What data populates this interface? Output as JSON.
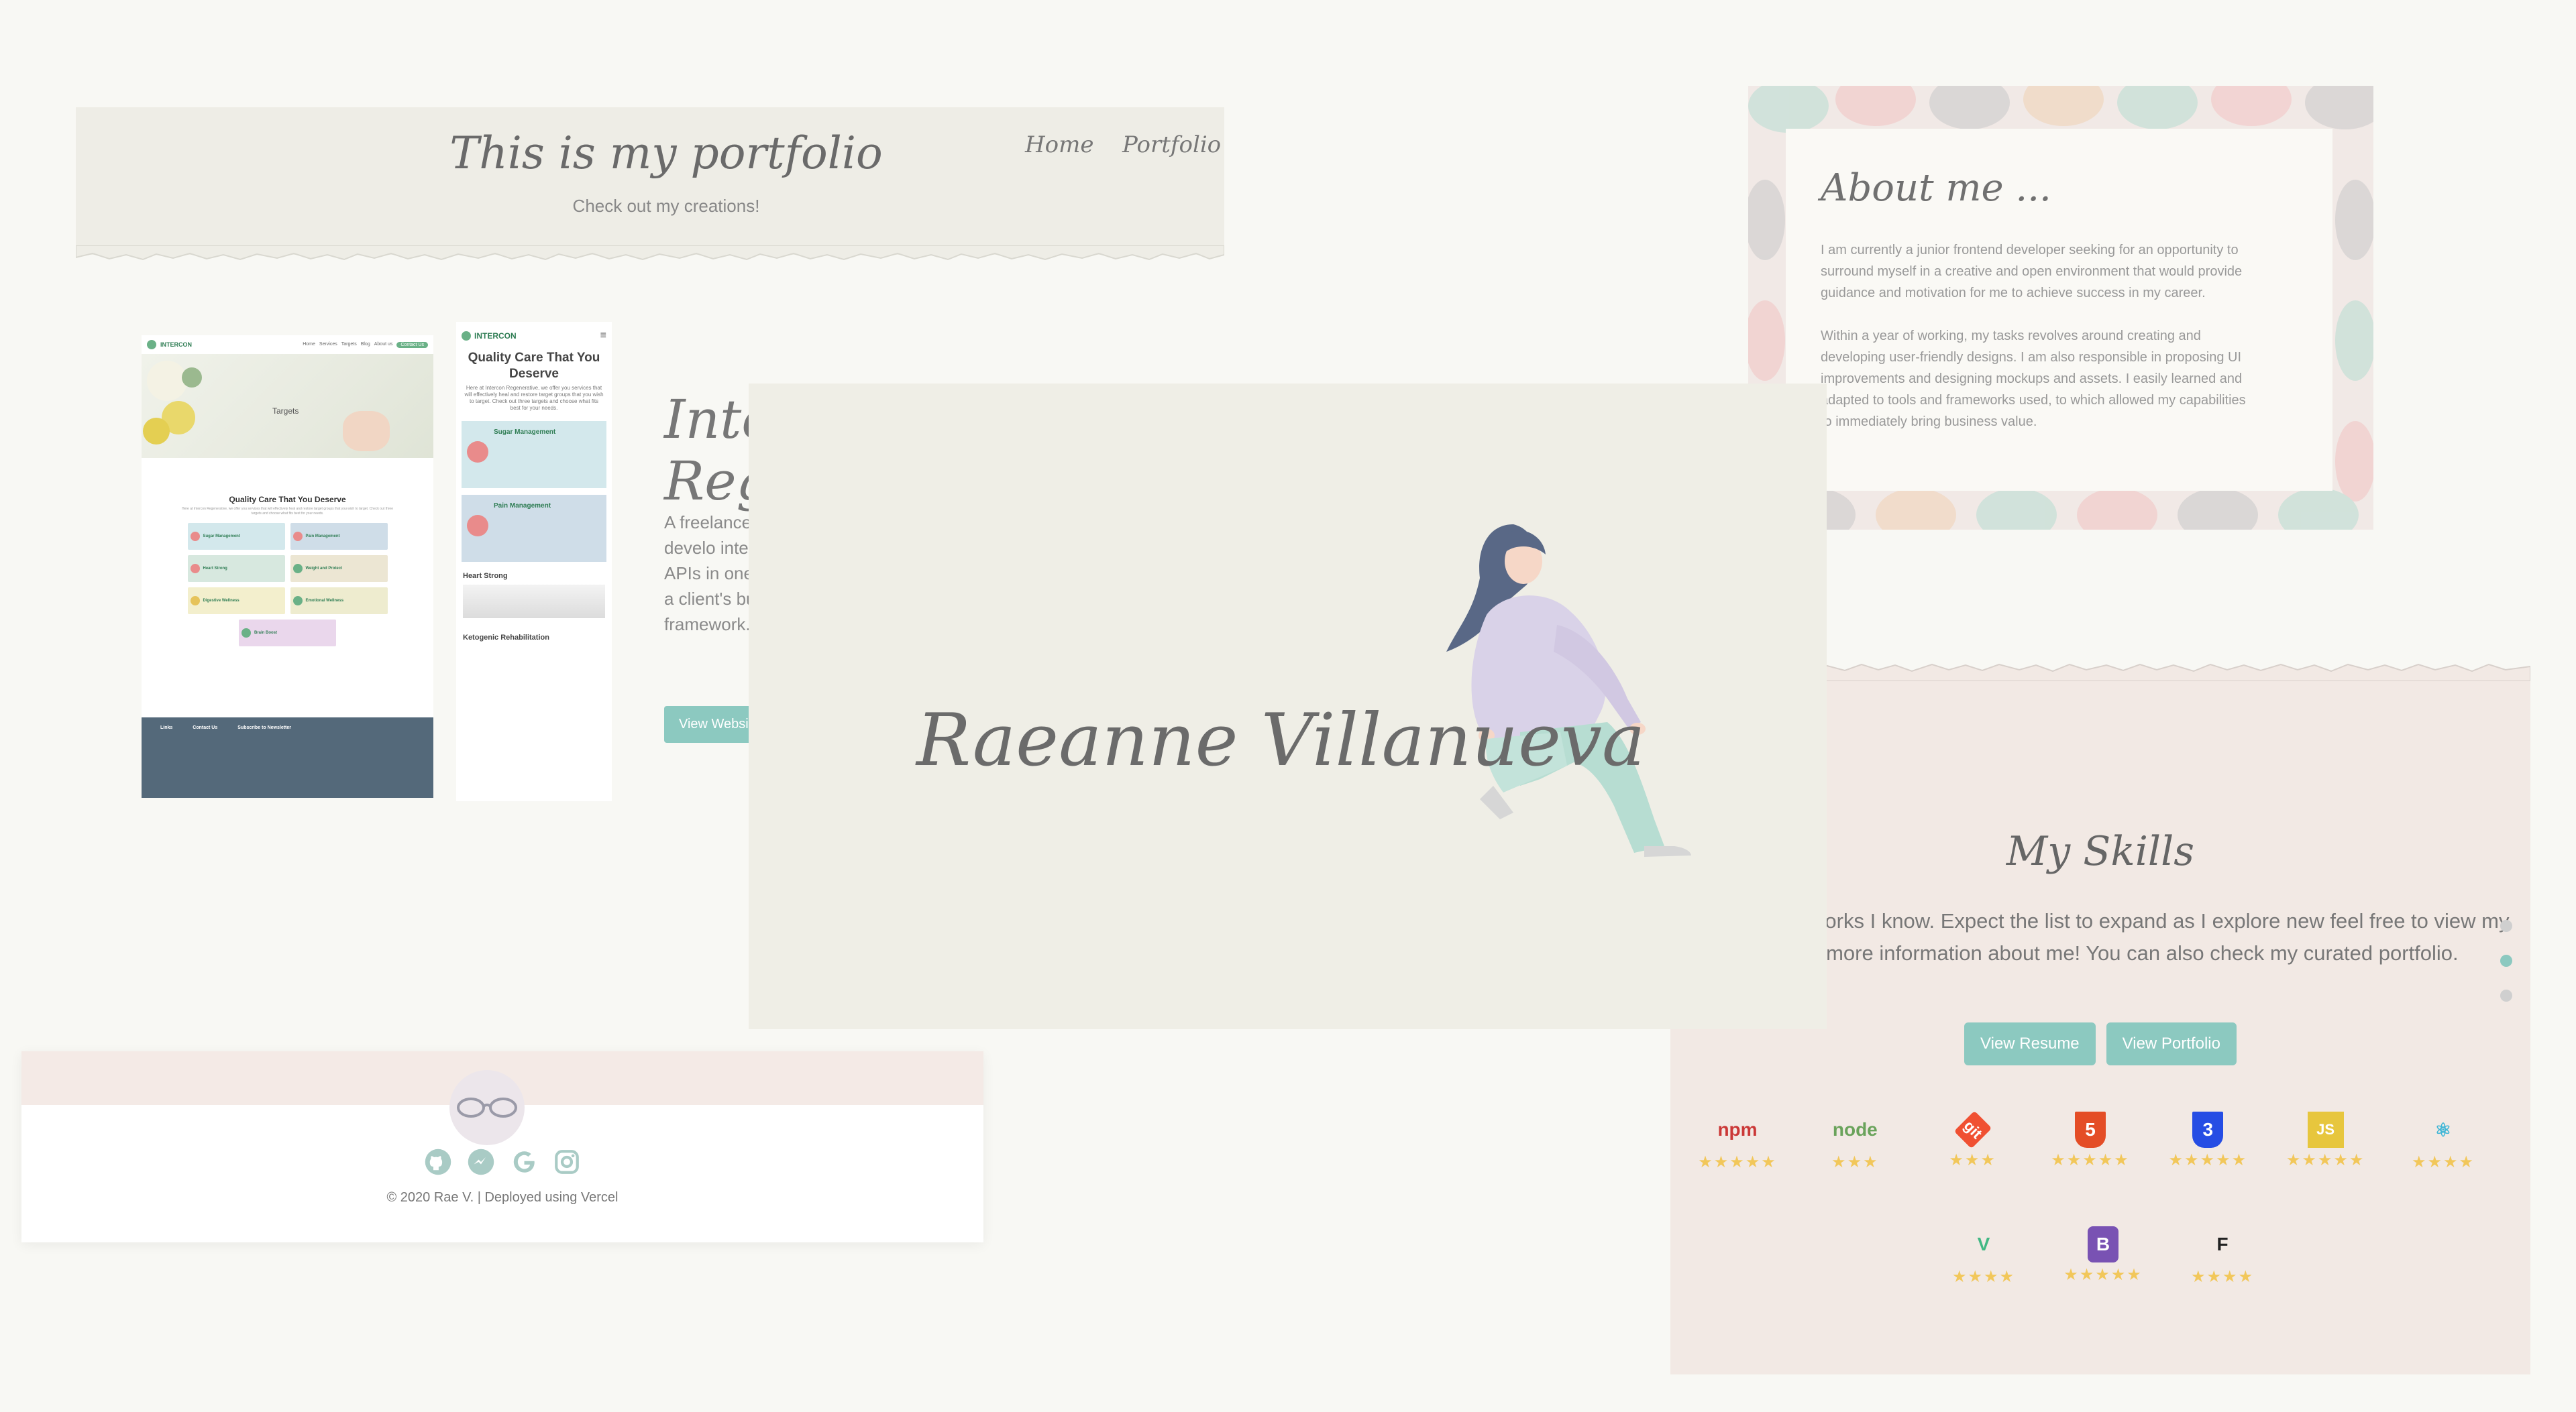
{
  "portfolio": {
    "title": "This is my portfolio",
    "subtitle": "Check out my creations!",
    "nav": [
      "Home",
      "Portfolio"
    ],
    "project_title_visible": "Inte\nRege",
    "project_desc_visible": "A freelance web develo integrate fro APIs in one project is a client's busi framework.",
    "project_button": "View Websit"
  },
  "mockup": {
    "brand": "INTERCON",
    "nav_links": [
      "Home",
      "Services",
      "Targets",
      "Blog",
      "About us"
    ],
    "nav_cta": "Contact Us",
    "hero_label": "Targets",
    "section_title": "Quality Care That You Deserve",
    "section_sub": "Here at Intercon Regenerative, we offer you services that will effectively heal and restore target groups that you wish to target. Check out three targets and choose what fits best for your needs.",
    "cards": [
      {
        "title": "Sugar Management",
        "color": "#d3e8ec",
        "dot": "#e98b8b"
      },
      {
        "title": "Pain Management",
        "color": "#cfdde8",
        "dot": "#e98b8b"
      },
      {
        "title": "Heart Strong",
        "color": "#d7e8df",
        "dot": "#e98b8b"
      },
      {
        "title": "Weight and Protect",
        "color": "#ece6d3",
        "dot": "#6ab187"
      },
      {
        "title": "Digestive Wellness",
        "color": "#f3efcd",
        "dot": "#e6c35a"
      },
      {
        "title": "Emotional Wellness",
        "color": "#eeeccf",
        "dot": "#6ab187"
      }
    ],
    "card_single": {
      "title": "Brain Boost",
      "color": "#ead7ec",
      "dot": "#6ab187"
    },
    "footer": {
      "links_title": "Links",
      "contact_title": "Contact Us",
      "subscribe_title": "Subscribe to Newsletter"
    },
    "mobile": {
      "title": "Quality Care That You Deserve",
      "text": "Here at Intercon Regenerative, we offer you services that will effectively heal and restore target groups that you wish to target. Check out three targets and choose what fits best for your needs.",
      "cards": [
        {
          "title": "Sugar Management",
          "color": "#d3e8ec",
          "dot": "#e98b8b"
        },
        {
          "title": "Pain Management",
          "color": "#cfdde8",
          "dot": "#e98b8b"
        }
      ],
      "section1": "Heart Strong",
      "section2": "Ketogenic Rehabilitation"
    }
  },
  "hero": {
    "name": "Raeanne Villanueva"
  },
  "about": {
    "title": "About me ...",
    "paragraphs": [
      "I am currently a junior frontend developer seeking for an opportunity to surround myself in a creative and open environment that would provide guidance and motivation for me to achieve success in my career.",
      "Within a year of working, my tasks revolves around creating and developing user-friendly designs. I am also responsible in proposing UI improvements and designing mockups and assets. I easily learned and adapted to tools and frameworks used, to which allowed my capabilities to immediately bring business value."
    ]
  },
  "skills": {
    "title": "My Skills",
    "text": "ne of the frameworks I know. Expect the list to expand as I explore new feel free to view my resume for more information about me! You can also check my curated portfolio.",
    "buttons": [
      "View Resume",
      "View Portfolio"
    ],
    "items": [
      {
        "icon": "npm-icon",
        "label": "npm",
        "color": "#cb3837",
        "stars": 5
      },
      {
        "icon": "node-icon",
        "label": "node",
        "color": "#6aa35b",
        "stars": 3
      },
      {
        "icon": "git-icon",
        "label": "git",
        "color": "#f05032",
        "stars": 3
      },
      {
        "icon": "html5-icon",
        "label": "5",
        "color": "#e44d26",
        "stars": 5
      },
      {
        "icon": "css3-icon",
        "label": "3",
        "color": "#264de4",
        "stars": 5
      },
      {
        "icon": "javascript-icon",
        "label": "JS",
        "color": "#e7c63d",
        "stars": 5
      },
      {
        "icon": "react-icon",
        "label": "⚛",
        "color": "#3fb6d6",
        "stars": 4
      },
      {
        "icon": "vue-icon",
        "label": "V",
        "color": "#41b883",
        "stars": 4
      },
      {
        "icon": "bootstrap-icon",
        "label": "B",
        "color": "#7952b3",
        "stars": 5
      },
      {
        "icon": "figma-icon",
        "label": "F",
        "color": "#222222",
        "stars": 4
      }
    ],
    "active_dot": 1
  },
  "footer": {
    "copyright": "© 2020 Rae V. | Deployed using Vercel",
    "social": [
      "github-icon",
      "messenger-icon",
      "google-icon",
      "instagram-icon"
    ]
  },
  "colors": {
    "accent": "#8cc9c0",
    "background": "#f8f8f4",
    "star": "#f2c75a"
  }
}
